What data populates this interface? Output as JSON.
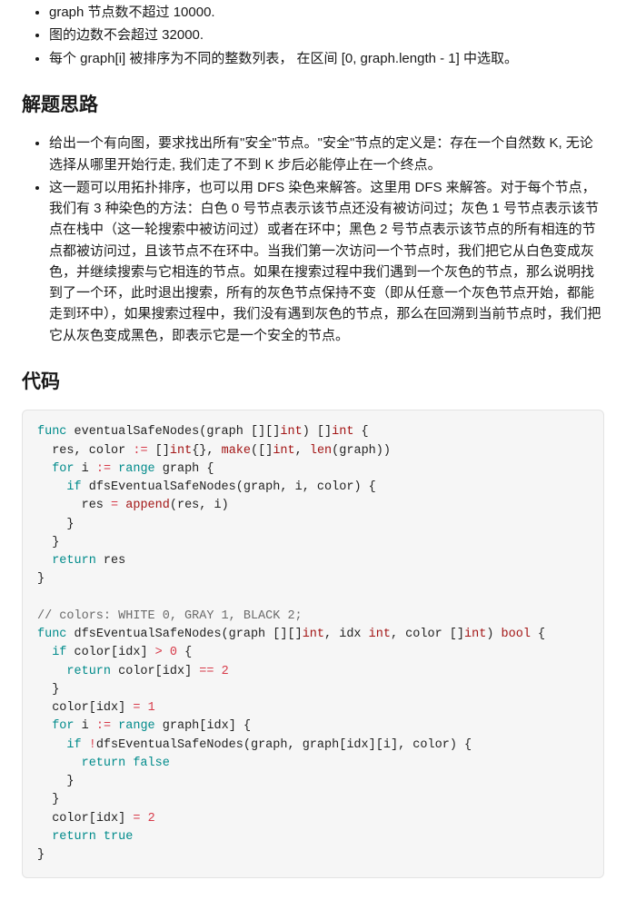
{
  "constraints": [
    "graph 节点数不超过 10000.",
    "图的边数不会超过 32000.",
    "每个 graph[i] 被排序为不同的整数列表， 在区间 [0, graph.length - 1] 中选取。"
  ],
  "h_approach": "解题思路",
  "approach": [
    "给出一个有向图，要求找出所有\"安全\"节点。\"安全\"节点的定义是：存在一个自然数 K, 无论选择从哪里开始行走, 我们走了不到 K 步后必能停止在一个终点。",
    "这一题可以用拓扑排序，也可以用 DFS 染色来解答。这里用 DFS 来解答。对于每个节点，我们有 3 种染色的方法：白色 0 号节点表示该节点还没有被访问过；灰色 1 号节点表示该节点在栈中（这一轮搜索中被访问过）或者在环中；黑色 2 号节点表示该节点的所有相连的节点都被访问过，且该节点不在环中。当我们第一次访问一个节点时，我们把它从白色变成灰色，并继续搜索与它相连的节点。如果在搜索过程中我们遇到一个灰色的节点，那么说明找到了一个环，此时退出搜索，所有的灰色节点保持不变（即从任意一个灰色节点开始，都能走到环中），如果搜索过程中，我们没有遇到灰色的节点，那么在回溯到当前节点时，我们把它从灰色变成黑色，即表示它是一个安全的节点。"
  ],
  "h_code": "代码",
  "code": {
    "kw_func": "func",
    "fn1": "eventualSafeNodes",
    "p_open": "(",
    "p_close": ")",
    "brace_open": "{",
    "brace_close": "}",
    "brack_open": "[",
    "brack_close": "]",
    "bb": "[]",
    "bbbb": "[][]",
    "p_graph": "graph",
    "t_int": "int",
    "v_res": "res",
    "v_color": "color",
    "op_decl": ":=",
    "empty_brace": "{}",
    "comma": ",",
    "fn_make": "make",
    "fn_len": "len",
    "fn_append": "append",
    "kw_for": "for",
    "v_i": "i",
    "kw_range": "range",
    "kw_if": "if",
    "fn2": "dfsEventualSafeNodes",
    "op_eq": "=",
    "kw_return": "return",
    "comment1": "// colors: WHITE 0, GRAY 1, BLACK 2;",
    "v_idx": "idx",
    "t_bool": "bool",
    "op_gt": ">",
    "lit0": "0",
    "op_eqeq": "==",
    "lit2": "2",
    "lit1": "1",
    "op_not": "!",
    "kw_false": "false",
    "kw_true": "true"
  }
}
